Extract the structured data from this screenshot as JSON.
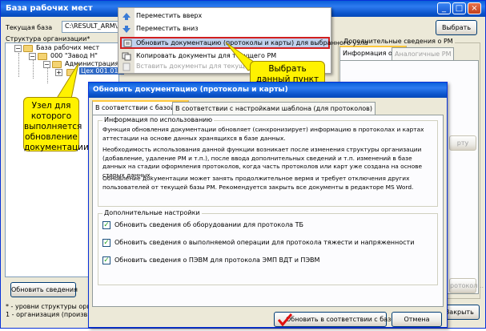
{
  "window": {
    "title": "База рабочих мест",
    "controls": [
      "_",
      "□",
      "×"
    ]
  },
  "toolbar": {
    "current_base_label": "Текущая база",
    "current_base_value": "C:\\RESULT_ARM\\ARM0",
    "select_button": "Выбрать"
  },
  "structure": {
    "label": "Структура организации*",
    "tree": [
      {
        "label": "База рабочих мест",
        "level": 0
      },
      {
        "label": "000 \"Завод Н\"",
        "level": 1
      },
      {
        "label": "Администрация",
        "level": 2
      },
      {
        "label": "Цех 001.012",
        "level": 3,
        "selected": true
      }
    ],
    "refresh_button": "Обновить сведения",
    "footnote_1": "* - уровни структуры организа",
    "footnote_2": "1 - организация (произв. объед"
  },
  "right_panel": {
    "group_label": "Дополнительные сведения о РМ",
    "tab_info": "Информация о РМ",
    "tab_similar": "Аналогичные РМ",
    "card_button": "рту",
    "protocol_button": "ротокол...",
    "close_button": "Закрыть"
  },
  "context_menu": {
    "items": [
      {
        "label": "Переместить вверх",
        "icon": "arrow-up-icon",
        "enabled": true
      },
      {
        "label": "Переместить вниз",
        "icon": "arrow-down-icon",
        "enabled": true
      },
      {
        "label": "Обновить документацию (протоколы и карты) для выбранного узла",
        "icon": "refresh-docs-icon",
        "enabled": true,
        "highlighted": true
      },
      {
        "label": "Копировать документы для текущего РМ",
        "icon": "copy-icon",
        "enabled": true
      },
      {
        "label": "Вставить документы для текущего РМ",
        "icon": "paste-icon",
        "enabled": false
      }
    ]
  },
  "callouts": {
    "right_click": "Выбрать данный пункт по правой кнопке мыши",
    "node": "Узел для которого выполняется обновление документации"
  },
  "dialog": {
    "title": "Обновить документацию (протоколы и карты)",
    "tab_base": "В соответствии с базой РМ",
    "tab_template": "В соответствии с настройками шаблона (для протоколов)",
    "info_group": "Информация по использованию",
    "info_p1": "Функция обновления документации обновляет (синхронизирует) информацию в протоколах и картах аттестации на основе данных хранящихся в базе данных.",
    "info_p2": "Необходимость использования данной функции возникает после изменения структуры организации (добавление, удаление РМ и т.п.), после ввода дополнительных сведений и т.п. изменений в базе данных на стадии оформления протоколов, когда часть протоколов или карт уже создана на основе старых данных.",
    "info_p3": "Обновление документации может занять продолжительное вермя и требует отключения других пользователей от текущей базы РМ. Рекомендуется закрыть все документы в редакторе MS Word.",
    "settings_group": "Дополнительные настройки",
    "settings": [
      {
        "label": "Обновить сведения об оборудовании для протокола ТБ",
        "checked": true
      },
      {
        "label": "Обновить сведения о выполняемой операции для протокола тяжести и напряженности",
        "checked": true
      },
      {
        "label": "Обновить сведения о ПЭВМ для протокола ЭМП ВДТ и ПЭВМ",
        "checked": true
      }
    ],
    "ok_button": "Обновить в соответствии с базой РМ",
    "cancel_button": "Отмена"
  },
  "colors": {
    "titlebar": "#0a5fd9",
    "callout": "#fff200",
    "highlight_border": "#d21f1f",
    "selection": "#316ac5"
  }
}
